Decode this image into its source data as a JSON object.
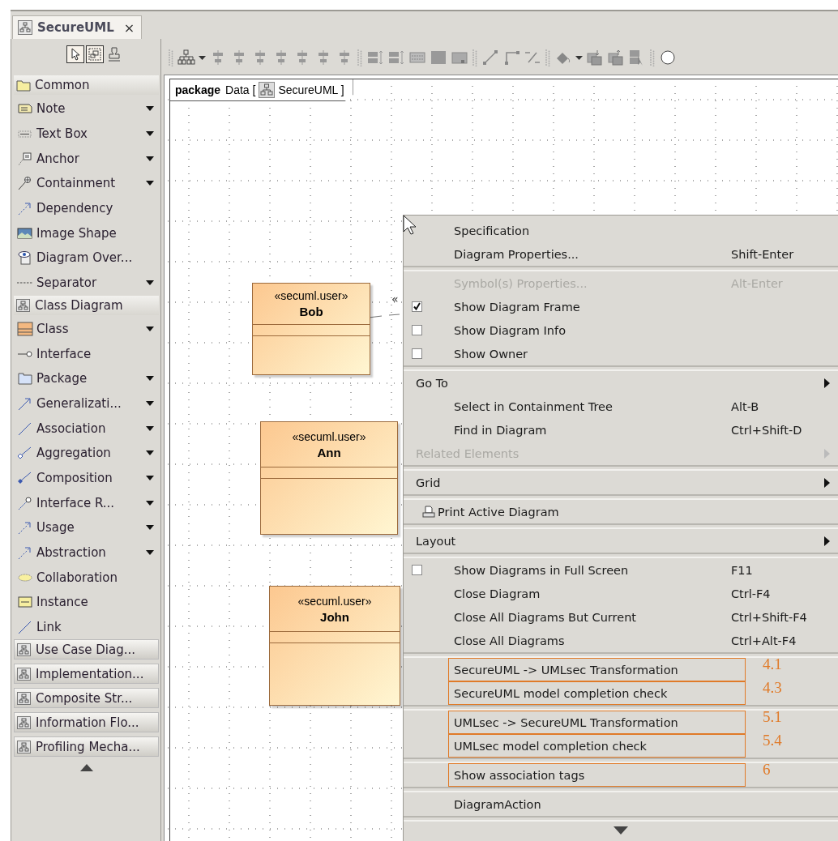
{
  "editor_tab": {
    "title": "SecureUML",
    "close": "×"
  },
  "palette": {
    "sections": [
      {
        "title": "Common",
        "expanded": true,
        "items": [
          {
            "label": "Note",
            "dropdown": true
          },
          {
            "label": "Text Box",
            "dropdown": true
          },
          {
            "label": "Anchor",
            "dropdown": true
          },
          {
            "label": "Containment",
            "dropdown": true
          },
          {
            "label": "Dependency",
            "dropdown": false
          },
          {
            "label": "Image Shape",
            "dropdown": false
          },
          {
            "label": "Diagram Over...",
            "dropdown": false
          },
          {
            "label": "Separator",
            "dropdown": true
          }
        ]
      },
      {
        "title": "Class Diagram",
        "expanded": true,
        "items": [
          {
            "label": "Class",
            "dropdown": true
          },
          {
            "label": "Interface",
            "dropdown": false
          },
          {
            "label": "Package",
            "dropdown": true
          },
          {
            "label": "Generalizati...",
            "dropdown": true
          },
          {
            "label": "Association",
            "dropdown": true
          },
          {
            "label": "Aggregation",
            "dropdown": true
          },
          {
            "label": "Composition",
            "dropdown": true
          },
          {
            "label": "Interface R...",
            "dropdown": true
          },
          {
            "label": "Usage",
            "dropdown": true
          },
          {
            "label": "Abstraction",
            "dropdown": true
          },
          {
            "label": "Collaboration",
            "dropdown": false
          },
          {
            "label": "Instance",
            "dropdown": false
          },
          {
            "label": "Link",
            "dropdown": false
          }
        ]
      },
      {
        "title": "Use Case Diag...",
        "expanded": false
      },
      {
        "title": "Implementation...",
        "expanded": false
      },
      {
        "title": "Composite Str...",
        "expanded": false
      },
      {
        "title": "Information Flo...",
        "expanded": false
      },
      {
        "title": "Profiling Mecha...",
        "expanded": false
      }
    ]
  },
  "diagram": {
    "frame": {
      "keyword": "package",
      "name": "Data [",
      "diagram": "SecureUML ]"
    },
    "classes": [
      {
        "stereotype": "«secuml.user»",
        "name": "Bob"
      },
      {
        "stereotype": "«secuml.user»",
        "name": "Ann"
      },
      {
        "stereotype": "«secuml.user»",
        "name": "John"
      }
    ],
    "connector_label": "«"
  },
  "context_menu": {
    "groups": [
      [
        {
          "kind": "command",
          "label": "Specification",
          "disabled": false
        },
        {
          "kind": "command",
          "label": "Diagram Properties...",
          "shortcut": "Shift-Enter",
          "disabled": false
        }
      ],
      [
        {
          "kind": "command",
          "label": "Symbol(s) Properties...",
          "shortcut": "Alt-Enter",
          "disabled": true
        },
        {
          "kind": "checkbox",
          "label": "Show Diagram Frame",
          "checked": true,
          "disabled": false
        },
        {
          "kind": "checkbox",
          "label": "Show Diagram Info",
          "checked": false,
          "disabled": false
        },
        {
          "kind": "checkbox",
          "label": "Show Owner",
          "checked": false,
          "disabled": false
        }
      ],
      [
        {
          "kind": "submenu",
          "label": "Go To",
          "disabled": false
        },
        {
          "kind": "command",
          "label": "Select in Containment Tree",
          "shortcut": "Alt-B",
          "disabled": false
        },
        {
          "kind": "command",
          "label": "Find in Diagram",
          "shortcut": "Ctrl+Shift-D",
          "disabled": false
        },
        {
          "kind": "submenu",
          "label": "Related Elements",
          "disabled": true
        }
      ],
      [
        {
          "kind": "submenu",
          "label": "Grid",
          "disabled": false
        }
      ],
      [
        {
          "kind": "print",
          "label": "Print Active Diagram",
          "disabled": false
        }
      ],
      [
        {
          "kind": "submenu",
          "label": "Layout",
          "disabled": false
        }
      ],
      [
        {
          "kind": "checkbox",
          "label": "Show Diagrams in Full Screen",
          "shortcut": "F11",
          "checked": false,
          "disabled": false
        },
        {
          "kind": "command",
          "label": "Close Diagram",
          "shortcut": "Ctrl-F4",
          "disabled": false
        },
        {
          "kind": "command",
          "label": "Close All Diagrams But Current",
          "shortcut": "Ctrl+Shift-F4",
          "disabled": false
        },
        {
          "kind": "command",
          "label": "Close All Diagrams",
          "shortcut": "Ctrl+Alt-F4",
          "disabled": false
        }
      ],
      [
        {
          "kind": "command",
          "label": "SecureUML -> UMLsec Transformation",
          "annotation": "4.1",
          "disabled": false
        },
        {
          "kind": "command",
          "label": "SecureUML model completion check",
          "annotation": "4.3",
          "disabled": false
        }
      ],
      [
        {
          "kind": "command",
          "label": "UMLsec -> SecureUML Transformation",
          "annotation": "5.1",
          "disabled": false
        },
        {
          "kind": "command",
          "label": "UMLsec model completion check",
          "annotation": "5.4",
          "disabled": false
        }
      ],
      [
        {
          "kind": "command",
          "label": "Show association tags",
          "annotation": "6",
          "disabled": false
        }
      ],
      [
        {
          "kind": "command",
          "label": "DiagramAction",
          "disabled": false
        }
      ]
    ]
  }
}
